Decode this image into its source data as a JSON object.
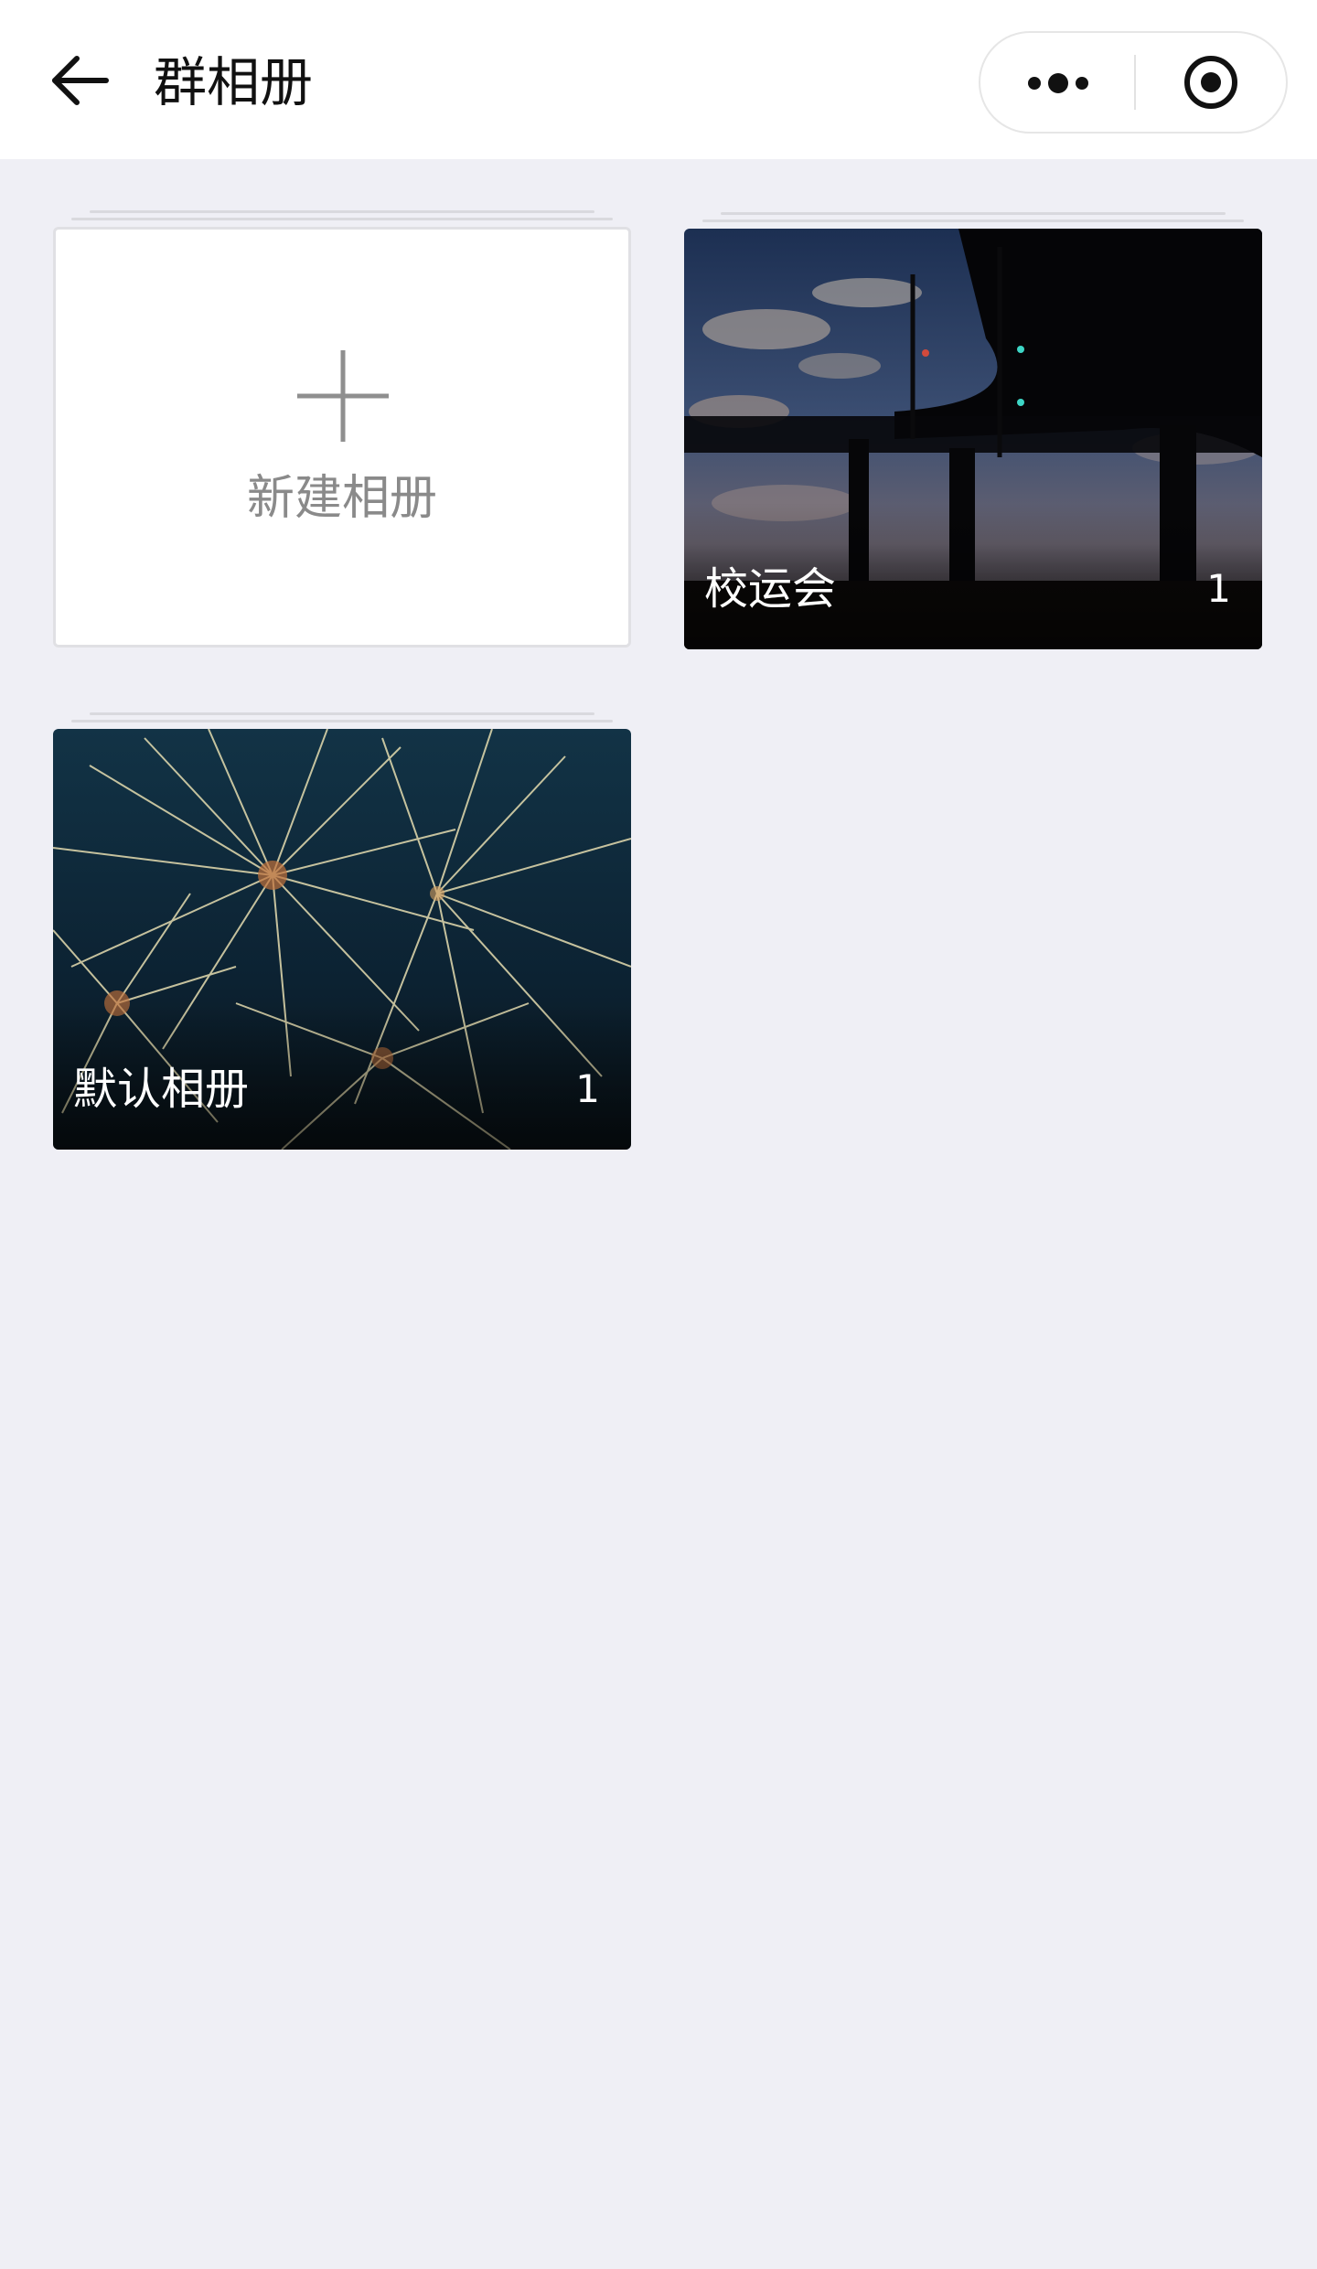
{
  "header": {
    "title": "群相册",
    "back_icon": "arrow-left-icon",
    "more_icon": "more-dots-icon",
    "close_icon": "target-circle-icon"
  },
  "new_album": {
    "label": "新建相册",
    "icon": "plus-icon"
  },
  "albums": [
    {
      "name": "校运会",
      "count": "1",
      "cover": "night-overpass-photo"
    },
    {
      "name": "默认相册",
      "count": "1",
      "cover": "fireworks-photo"
    }
  ],
  "colors": {
    "background": "#efeff5",
    "header_bg": "#ffffff",
    "placeholder_text": "#8a8a8a",
    "overlay_text": "#ffffff"
  }
}
